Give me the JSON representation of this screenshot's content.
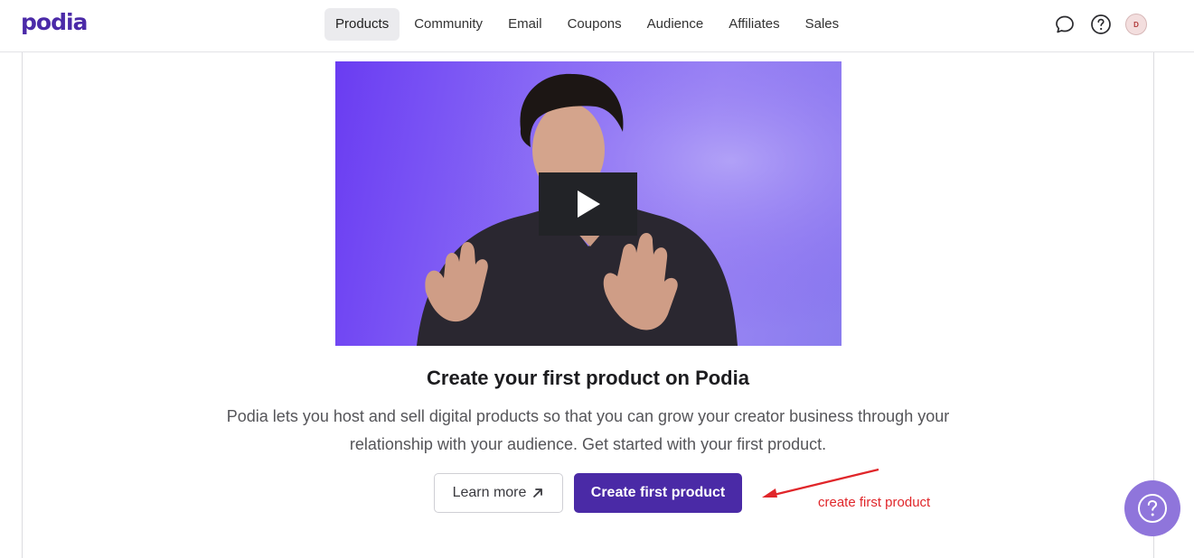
{
  "brand": {
    "logo_text": "podia",
    "accent_color": "#4a2aa6",
    "annotation_color": "#e0262a"
  },
  "nav": {
    "items": [
      {
        "label": "Products",
        "active": true
      },
      {
        "label": "Community",
        "active": false
      },
      {
        "label": "Email",
        "active": false
      },
      {
        "label": "Coupons",
        "active": false
      },
      {
        "label": "Audience",
        "active": false
      },
      {
        "label": "Affiliates",
        "active": false
      },
      {
        "label": "Sales",
        "active": false
      }
    ]
  },
  "header_icons": {
    "chat": "chat-bubble-icon",
    "help": "question-circle-icon",
    "avatar_initial": "D"
  },
  "video": {
    "play_icon": "play-icon"
  },
  "main": {
    "headline": "Create your first product on Podia",
    "description": "Podia lets you host and sell digital products so that you can grow your creator business through your relationship with your audience. Get started with your first product.",
    "learn_more_label": "Learn more",
    "create_label": "Create first product"
  },
  "annotation": {
    "text": "create first product"
  },
  "help_widget": {
    "icon": "question-circle-icon"
  }
}
